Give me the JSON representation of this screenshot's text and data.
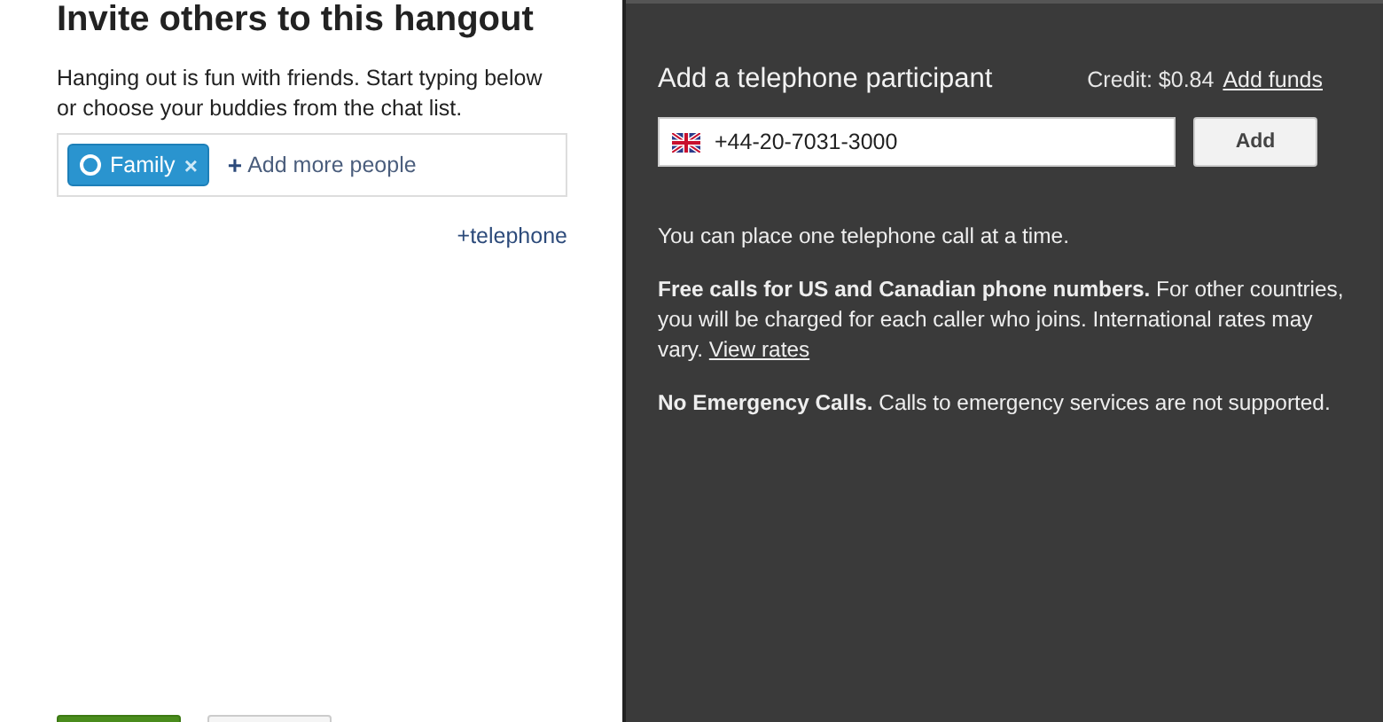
{
  "invite": {
    "title": "Invite others to this hangout",
    "description": "Hanging out is fun with friends. Start typing below or choose your buddies from the chat list.",
    "chips": [
      {
        "label": "Family",
        "remove": "×"
      }
    ],
    "add_more": {
      "icon": "+",
      "label": "Add more people"
    },
    "telephone_link": "+telephone",
    "buttons": [
      {
        "kind": "primary"
      },
      {
        "kind": "secondary"
      }
    ]
  },
  "phone": {
    "title": "Add a telephone participant",
    "credit": "Credit: $0.84",
    "add_funds": "Add funds",
    "number": "+44-20-7031-3000",
    "add_button": "Add",
    "notes": [
      {
        "text": "You can place one telephone call at a time."
      },
      {
        "text": "**Free calls for US and Canadian phone numbers.** For other countries, you will be charged for each caller who joins. International rates may vary.",
        "link": "View rates"
      },
      {
        "text": "**No Emergency Calls.** Calls to emergency services are not supported."
      }
    ]
  }
}
